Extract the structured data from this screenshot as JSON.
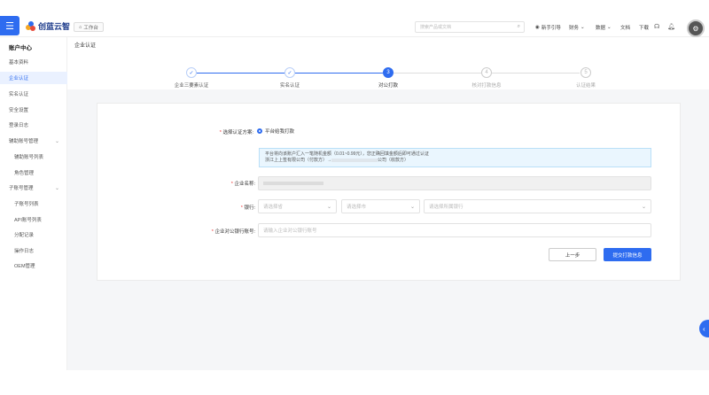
{
  "header": {
    "logo_text": "创蓝云智",
    "workspace_label": "工作台",
    "search_placeholder": "搜索产品或文档",
    "nav": {
      "guide": "新手引导",
      "finance": "财务",
      "data": "数据",
      "docs": "文档",
      "download": "下载"
    }
  },
  "sidebar": {
    "title": "账户中心",
    "items": [
      {
        "label": "基本资料"
      },
      {
        "label": "企业认证"
      },
      {
        "label": "实名认证"
      },
      {
        "label": "安全设置"
      },
      {
        "label": "登录日志"
      },
      {
        "label": "辅助账号管理"
      },
      {
        "label": "辅助账号列表"
      },
      {
        "label": "角色管理"
      },
      {
        "label": "子账号管理"
      },
      {
        "label": "子账号列表"
      },
      {
        "label": "API账号列表"
      },
      {
        "label": "分配记录"
      },
      {
        "label": "操作日志"
      },
      {
        "label": "OEM管理"
      }
    ]
  },
  "breadcrumb": "企业认证",
  "steps": [
    {
      "num": "✓",
      "label": "企业三要素认证"
    },
    {
      "num": "✓",
      "label": "实名认证"
    },
    {
      "num": "3",
      "label": "对公打款"
    },
    {
      "num": "4",
      "label": "核对打款信息"
    },
    {
      "num": "5",
      "label": "认证结果"
    }
  ],
  "form": {
    "method_label": "选择认证方案:",
    "method_option": "平台给我打款",
    "notice_line1": "平台将向该账户汇入一笔随机金额（0.01~0.99元），您正确回填金额后即可通过认证",
    "notice_line2_a": "浙江上上签有限公司（付款方）→",
    "notice_line2_b": "公司（收款方）",
    "company_label": "企业名称:",
    "bank_label": "银行:",
    "bank_placeholder": "请选择省",
    "city_placeholder": "请选择市",
    "branch_placeholder": "请选择所属银行",
    "account_label": "企业对公银行账号:",
    "account_placeholder": "请输入企业对公银行账号",
    "prev_button": "上一步",
    "submit_button": "提交打款信息"
  },
  "colors": {
    "accent": "#2e6cf0",
    "required": "#e33333"
  }
}
